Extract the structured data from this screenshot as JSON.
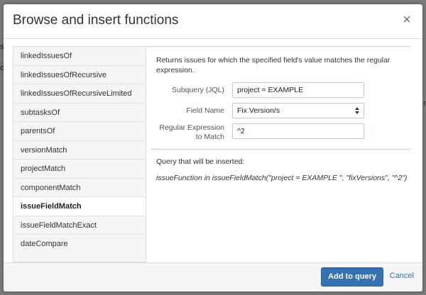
{
  "background": {
    "hint_left_1": "s",
    "hint_left_2": "o",
    "hint_right_1": "r"
  },
  "dialog": {
    "title": "Browse and insert functions",
    "close_icon": "×"
  },
  "functions": {
    "items": [
      "linkedIssuesOf",
      "linkedIssuesOfRecursive",
      "linkedIssuesOfRecursiveLimited",
      "subtasksOf",
      "parentsOf",
      "versionMatch",
      "projectMatch",
      "componentMatch",
      "issueFieldMatch",
      "issueFieldMatchExact",
      "dateCompare"
    ],
    "selected": "issueFieldMatch"
  },
  "detail": {
    "description": "Returns issues for which the specified field's value matches the regular expression.",
    "subquery_label": "Subquery (JQL)",
    "subquery_value": "project = EXAMPLE",
    "field_name_label": "Field Name",
    "field_name_value": "Fix Version/s",
    "regex_label_line1": "Regular Expression",
    "regex_label_line2": "to Match",
    "regex_value": "^2",
    "query_label": "Query that will be inserted:",
    "query_text": "issueFunction in issueFieldMatch(\"project = EXAMPLE \", \"fixVersions\", \"^2\")"
  },
  "footer": {
    "add_button": "Add to query",
    "cancel_link": "Cancel"
  },
  "colors": {
    "accent": "#3572b0",
    "overlay": "#7b7b7b"
  }
}
